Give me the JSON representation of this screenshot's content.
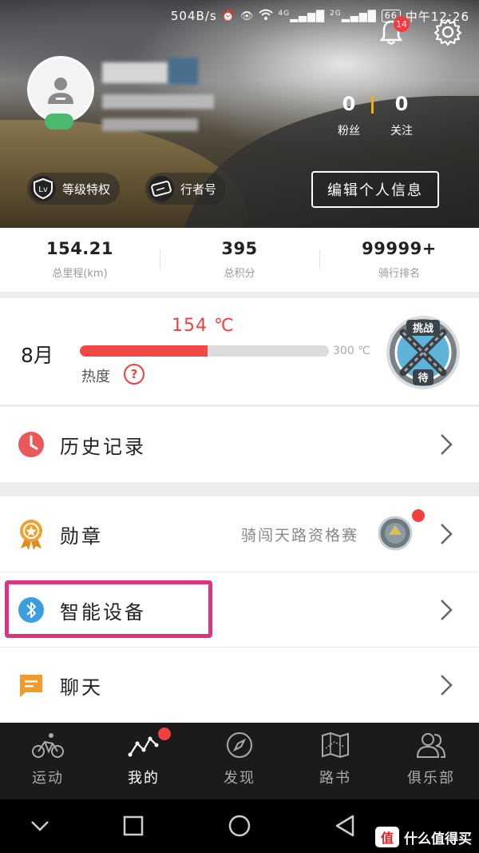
{
  "status_bar": {
    "speed": "504B/s",
    "network_1": "4G",
    "network_2": "2G",
    "battery": "66",
    "time": "中午12:26"
  },
  "header": {
    "notification_count": "14",
    "fans_count": "0",
    "fans_label": "粉丝",
    "follow_count": "0",
    "follow_label": "关注",
    "level_privilege_label": "等级特权",
    "rider_id_label": "行者号",
    "edit_profile_label": "编辑个人信息",
    "level_icon_text": "Lv"
  },
  "stats": [
    {
      "value": "154.21",
      "label": "总里程(km)"
    },
    {
      "value": "395",
      "label": "总积分"
    },
    {
      "value": "99999+",
      "label": "骑行排名"
    }
  ],
  "heat": {
    "month": "8月",
    "value": "154 ℃",
    "max": "300 ℃",
    "label": "热度",
    "help_icon": "?",
    "progress": 0.513,
    "badge_text_top": "挑战",
    "badge_text_bottom": "待"
  },
  "menu": {
    "history_label": "历史记录",
    "medal_label": "勋章",
    "medal_extra": "骑闯天路资格赛",
    "smart_device_label": "智能设备",
    "chat_label": "聊天"
  },
  "tabs": [
    {
      "label": "运动",
      "icon": "bike-icon"
    },
    {
      "label": "我的",
      "icon": "graph-icon"
    },
    {
      "label": "发现",
      "icon": "compass-icon"
    },
    {
      "label": "路书",
      "icon": "map-icon"
    },
    {
      "label": "俱乐部",
      "icon": "group-icon"
    }
  ],
  "watermark": {
    "logo": "值",
    "text": "什么值得买"
  },
  "colors": {
    "accent_red": "#f24848",
    "highlight_pink": "#e0337f",
    "tab_bar": "#1b1b1b"
  }
}
